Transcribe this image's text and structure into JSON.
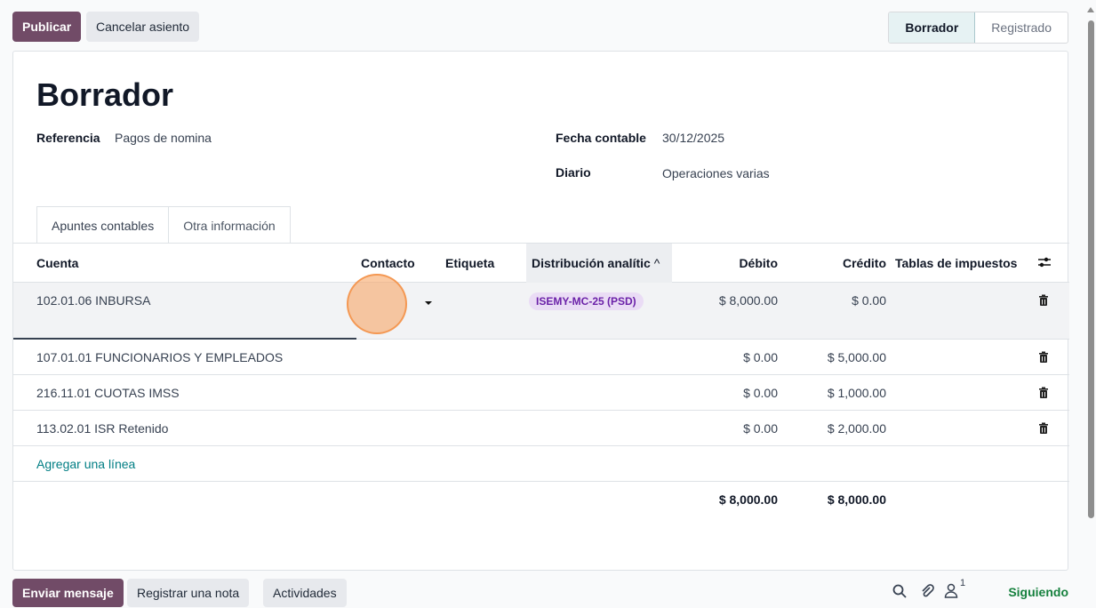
{
  "actions": {
    "publish": "Publicar",
    "cancel_entry": "Cancelar asiento"
  },
  "statusbar": {
    "steps": [
      "Borrador",
      "Registrado"
    ],
    "active": "Borrador"
  },
  "form": {
    "title": "Borrador",
    "reference_label": "Referencia",
    "reference_value": "Pagos de nomina",
    "date_label": "Fecha contable",
    "date_value": "30/12/2025",
    "journal_label": "Diario",
    "journal_value": "Operaciones varias"
  },
  "tabs": [
    "Apuntes contables",
    "Otra información"
  ],
  "table": {
    "headers": {
      "account": "Cuenta",
      "contact": "Contacto",
      "label": "Etiqueta",
      "analytic": "Distribución analític",
      "debit": "Débito",
      "credit": "Crédito",
      "taxes": "Tablas de impuestos"
    },
    "sort_indicator": "^",
    "rows": [
      {
        "account": "102.01.06 INBURSA",
        "analytic": "ISEMY-MC-25 (PSD)",
        "debit": "$ 8,000.00",
        "credit": "$ 0.00"
      },
      {
        "account": "107.01.01 FUNCIONARIOS Y EMPLEADOS",
        "analytic": "",
        "debit": "$ 0.00",
        "credit": "$ 5,000.00"
      },
      {
        "account": "216.11.01 CUOTAS IMSS",
        "analytic": "",
        "debit": "$ 0.00",
        "credit": "$ 1,000.00"
      },
      {
        "account": "113.02.01 ISR Retenido",
        "analytic": "",
        "debit": "$ 0.00",
        "credit": "$ 2,000.00"
      }
    ],
    "add_line": "Agregar una línea",
    "total_debit": "$ 8,000.00",
    "total_credit": "$ 8,000.00"
  },
  "chatter": {
    "send_message": "Enviar mensaje",
    "log_note": "Registrar una nota",
    "activities": "Actividades",
    "followers_count": "1",
    "following": "Siguiendo"
  },
  "icons": {
    "trash": "trash-icon",
    "settings": "column-settings-icon",
    "search": "search-icon",
    "attachment": "paperclip-icon",
    "followers": "user-icon"
  },
  "colors": {
    "primary": "#714b67",
    "link": "#017e84",
    "following": "#15803d"
  }
}
